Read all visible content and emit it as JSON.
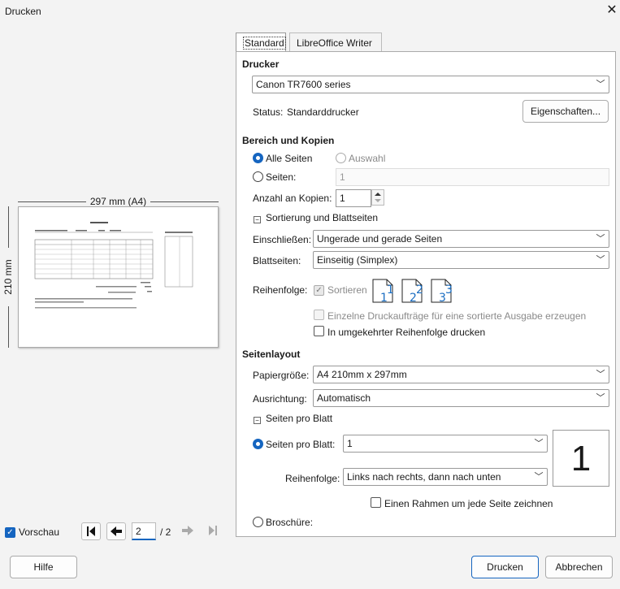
{
  "window": {
    "title": "Drucken",
    "close_glyph": "✕"
  },
  "preview": {
    "width_label": "297 mm (A4)",
    "height_label": "210 mm",
    "checkbox_label": "Vorschau",
    "page_current": "2",
    "page_total": "/ 2"
  },
  "tabs": [
    {
      "label": "Standard"
    },
    {
      "label": "LibreOffice Writer"
    }
  ],
  "printer": {
    "heading": "Drucker",
    "selected": "Canon TR7600 series",
    "status_label": "Status:",
    "status_value": "Standarddrucker",
    "properties_button": "Eigenschaften..."
  },
  "range": {
    "heading": "Bereich und Kopien",
    "all_pages": "Alle Seiten",
    "selection": "Auswahl",
    "pages": "Seiten:",
    "pages_value": "1",
    "copies_label": "Anzahl an Kopien:",
    "copies_value": "1",
    "collate_expander": "Sortierung und Blattseiten",
    "include_label": "Einschließen:",
    "include_value": "Ungerade und gerade Seiten",
    "sides_label": "Blattseiten:",
    "sides_value": "Einseitig (Simplex)",
    "order_label": "Reihenfolge:",
    "sort_label": "Sortieren",
    "separate_jobs": "Einzelne Druckaufträge für eine sortierte Ausgabe erzeugen",
    "reverse_order": "In umgekehrter Reihenfolge drucken",
    "page_numbers": [
      "1",
      "2",
      "3"
    ]
  },
  "layout": {
    "heading": "Seitenlayout",
    "paper_label": "Papiergröße:",
    "paper_value": "A4 210mm x 297mm",
    "orientation_label": "Ausrichtung:",
    "orientation_value": "Automatisch",
    "pps_expander": "Seiten pro Blatt",
    "pps_label": "Seiten pro Blatt:",
    "pps_value": "1",
    "pps_order_label": "Reihenfolge:",
    "pps_order_value": "Links nach rechts, dann nach unten",
    "border_label": "Einen Rahmen um jede Seite zeichnen",
    "brochure_label": "Broschüre:",
    "preview_number": "1"
  },
  "footer": {
    "help": "Hilfe",
    "print": "Drucken",
    "cancel": "Abbrechen"
  },
  "colors": {
    "accent": "#1565c0"
  }
}
